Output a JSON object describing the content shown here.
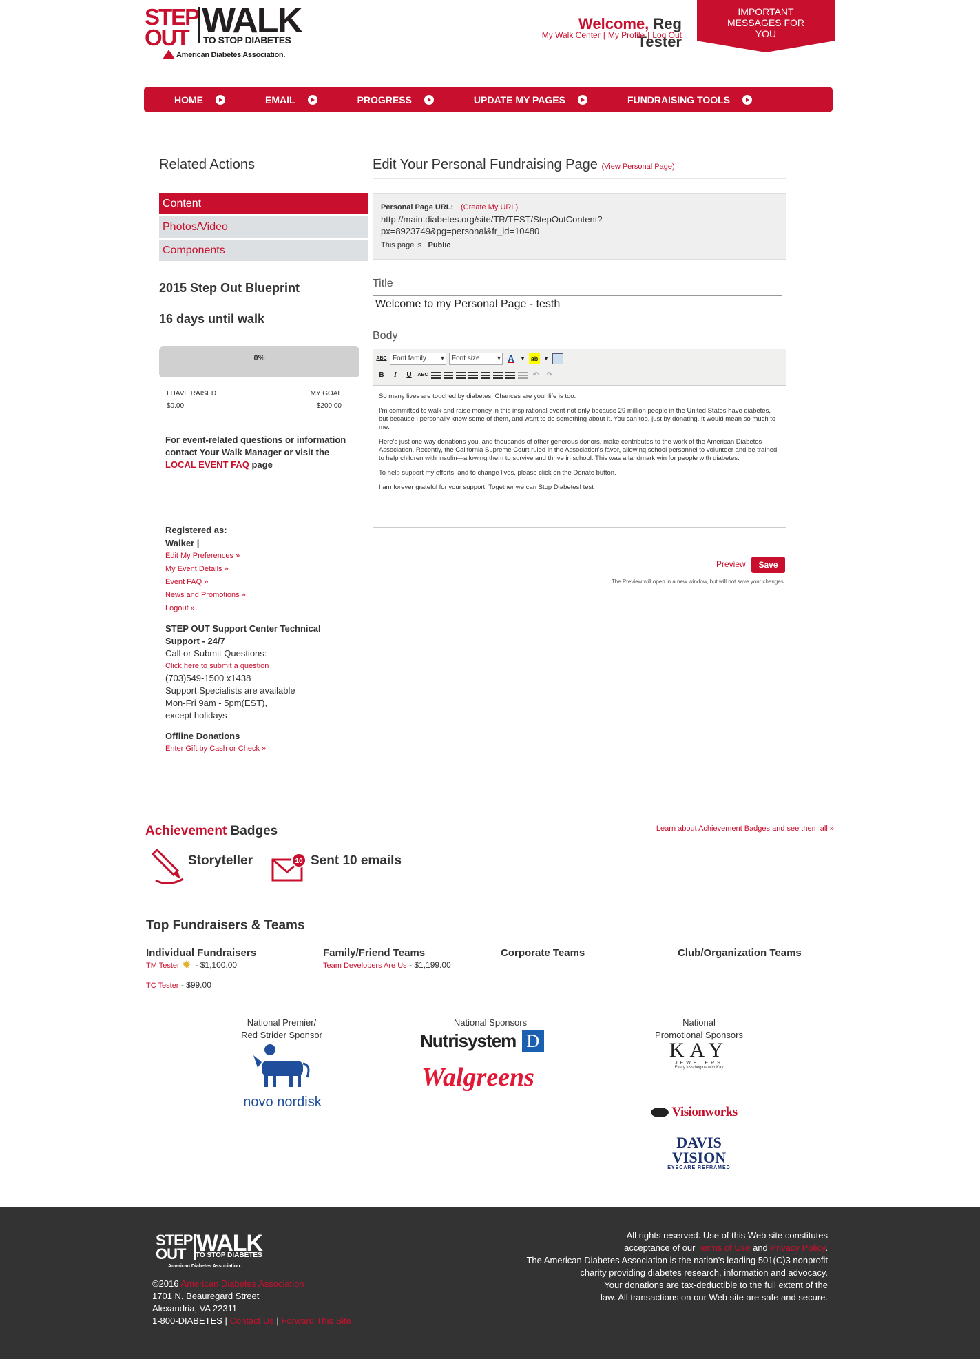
{
  "header": {
    "logo_step": "STEP",
    "logo_out": "OUT",
    "logo_walk": "WALK",
    "logo_sub": "TO STOP DIABETES",
    "ada": "American Diabetes Association.",
    "welcome_label": "Welcome,",
    "user_name": "Reg Tester",
    "links": [
      "My Walk Center",
      "My Profile",
      "Log Out"
    ],
    "important_messages": "IMPORTANT MESSAGES FOR YOU"
  },
  "nav": {
    "items": [
      "HOME",
      "EMAIL",
      "PROGRESS",
      "UPDATE MY PAGES",
      "FUNDRAISING TOOLS"
    ]
  },
  "sidebar": {
    "heading": "Related Actions",
    "subnav": [
      "Content",
      "Photos/Video",
      "Components"
    ],
    "blueprint": "2015 Step Out Blueprint",
    "days_until": "16 days until walk",
    "progress": {
      "percent_label": "0%",
      "fraction": 0,
      "raised_label": "I HAVE RAISED",
      "raised_value": "$0.00",
      "goal_label": "MY GOAL",
      "goal_value": "$200.00"
    },
    "event_questions": "For event-related questions or information contact Your Walk Manager or visit the",
    "event_faq_link": "LOCAL EVENT FAQ",
    "event_faq_suffix": "page",
    "registered_as_label": "Registered as:",
    "registered_as_value": "Walker |",
    "reg_links": [
      "Edit My Preferences »",
      "My Event Details »",
      "Event FAQ »",
      "News and Promotions »",
      "Logout »"
    ],
    "support_heading": "STEP OUT Support Center Technical Support - 24/7",
    "support_call": "Call or Submit Questions:",
    "support_link": "Click here to submit a question",
    "support_phone": "(703)549-1500 x1438",
    "support_hours_1": "Support Specialists are available",
    "support_hours_2": "Mon-Fri 9am - 5pm(EST),",
    "support_hours_3": "except holidays",
    "offline_heading": "Offline Donations",
    "offline_link": "Enter Gift by Cash or Check »"
  },
  "main": {
    "heading": "Edit Your Personal Fundraising Page",
    "view_link": "(View Personal Page)",
    "url_label": "Personal Page URL:",
    "create_url_link": "(Create My URL)",
    "url_line1": "http://main.diabetes.org/site/TR/TEST/StepOutContent?",
    "url_line2": "px=8923749&pg=personal&fr_id=10480",
    "page_status_label": "This page is",
    "page_status": "Public",
    "title_label": "Title",
    "title_value": "Welcome to my Personal Page - testh",
    "body_label": "Body",
    "toolbar": {
      "font_family": "Font family",
      "font_size": "Font size"
    },
    "body_paragraphs": [
      "So many lives are touched by diabetes. Chances are your life is too.",
      "I'm committed to walk and raise money in this inspirational event not only because 29 million people in the United States have diabetes, but because I personally know some of them, and want to do something about it. You can too, just by donating. It would mean so much to me.",
      "Here's just one way donations you, and thousands of other generous donors, make contributes to the work of the American Diabetes Association. Recently, the California Supreme Court ruled in the Association's favor, allowing school personnel to volunteer and be trained to help children with insulin—allowing them to survive and thrive in school. This was a landmark win for people with diabetes.",
      "To help support my efforts, and to change lives, please click on the Donate button.",
      "I am forever grateful for your support. Together we can Stop Diabetes! test"
    ],
    "preview_label": "Preview",
    "save_label": "Save",
    "preview_note": "The Preview will open in a new window, but will not save your changes."
  },
  "badges": {
    "heading_red": "Achievement",
    "heading_rest": "Badges",
    "learn_link": "Learn about Achievement Badges and see them all »",
    "items": [
      {
        "label": "Storyteller",
        "icon": "pen-icon"
      },
      {
        "label": "Sent 10 emails",
        "icon": "envelope-icon",
        "count": "10"
      }
    ]
  },
  "top_fundraisers": {
    "heading": "Top Fundraisers & Teams",
    "columns": [
      "Individual Fundraisers",
      "Family/Friend Teams",
      "Corporate Teams",
      "Club/Organization Teams"
    ],
    "individual": [
      {
        "name": "TM Tester",
        "amount": "- $1,100.00"
      },
      {
        "name": "TC Tester",
        "amount": "- $99.00"
      }
    ],
    "family": [
      {
        "name": "Team Developers Are Us",
        "amount": "- $1,199.00"
      }
    ]
  },
  "sponsors": {
    "premier_label_1": "National Premier/",
    "premier_label_2": "Red Strider Sponsor",
    "national_label": "National Sponsors",
    "promo_label_1": "National",
    "promo_label_2": "Promotional Sponsors",
    "logos": {
      "novo": "novo nordisk",
      "nutri": "Nutrisystem",
      "nutri_d": "D",
      "walgreens": "Walgreens",
      "kay": "KAY",
      "kay_sub": "JEWELERS",
      "kay_tag": "Every kiss begins with Kay",
      "visionworks": "Visionworks",
      "davis": "DAVIS VISION",
      "davis_sub": "EYECARE REFRAMED"
    }
  },
  "footer": {
    "logo_step": "STEP",
    "logo_out": "OUT",
    "logo_walk": "WALK",
    "logo_sub": "TO STOP DIABETES",
    "ada": "American Diabetes Association.",
    "copyright": "©2016",
    "org_link": "American Diabetes Association",
    "street": "1701 N. Beauregard Street",
    "city": "Alexandria, VA 22311",
    "phone": "1-800-DIABETES",
    "contact_link": "Contact Us",
    "forward_link": "Forward This Site",
    "rights_1": "All rights reserved. Use of this Web site constitutes",
    "rights_2a": "acceptance of our",
    "terms_link": "Terms of Use",
    "rights_2b": "and",
    "privacy_link": "Privacy Policy",
    "rights_3": "The American Diabetes Association is the nation's leading 501(C)3 nonprofit",
    "rights_4": "charity providing diabetes research, information and advocacy.",
    "rights_5": "Your donations are tax-deductible to the full extent of the",
    "rights_6": "law. All transactions on our Web site are safe and secure."
  },
  "colors": {
    "brand_red": "#c8102e",
    "footer_bg": "#333333",
    "subnav_bg": "#dde0e3"
  }
}
